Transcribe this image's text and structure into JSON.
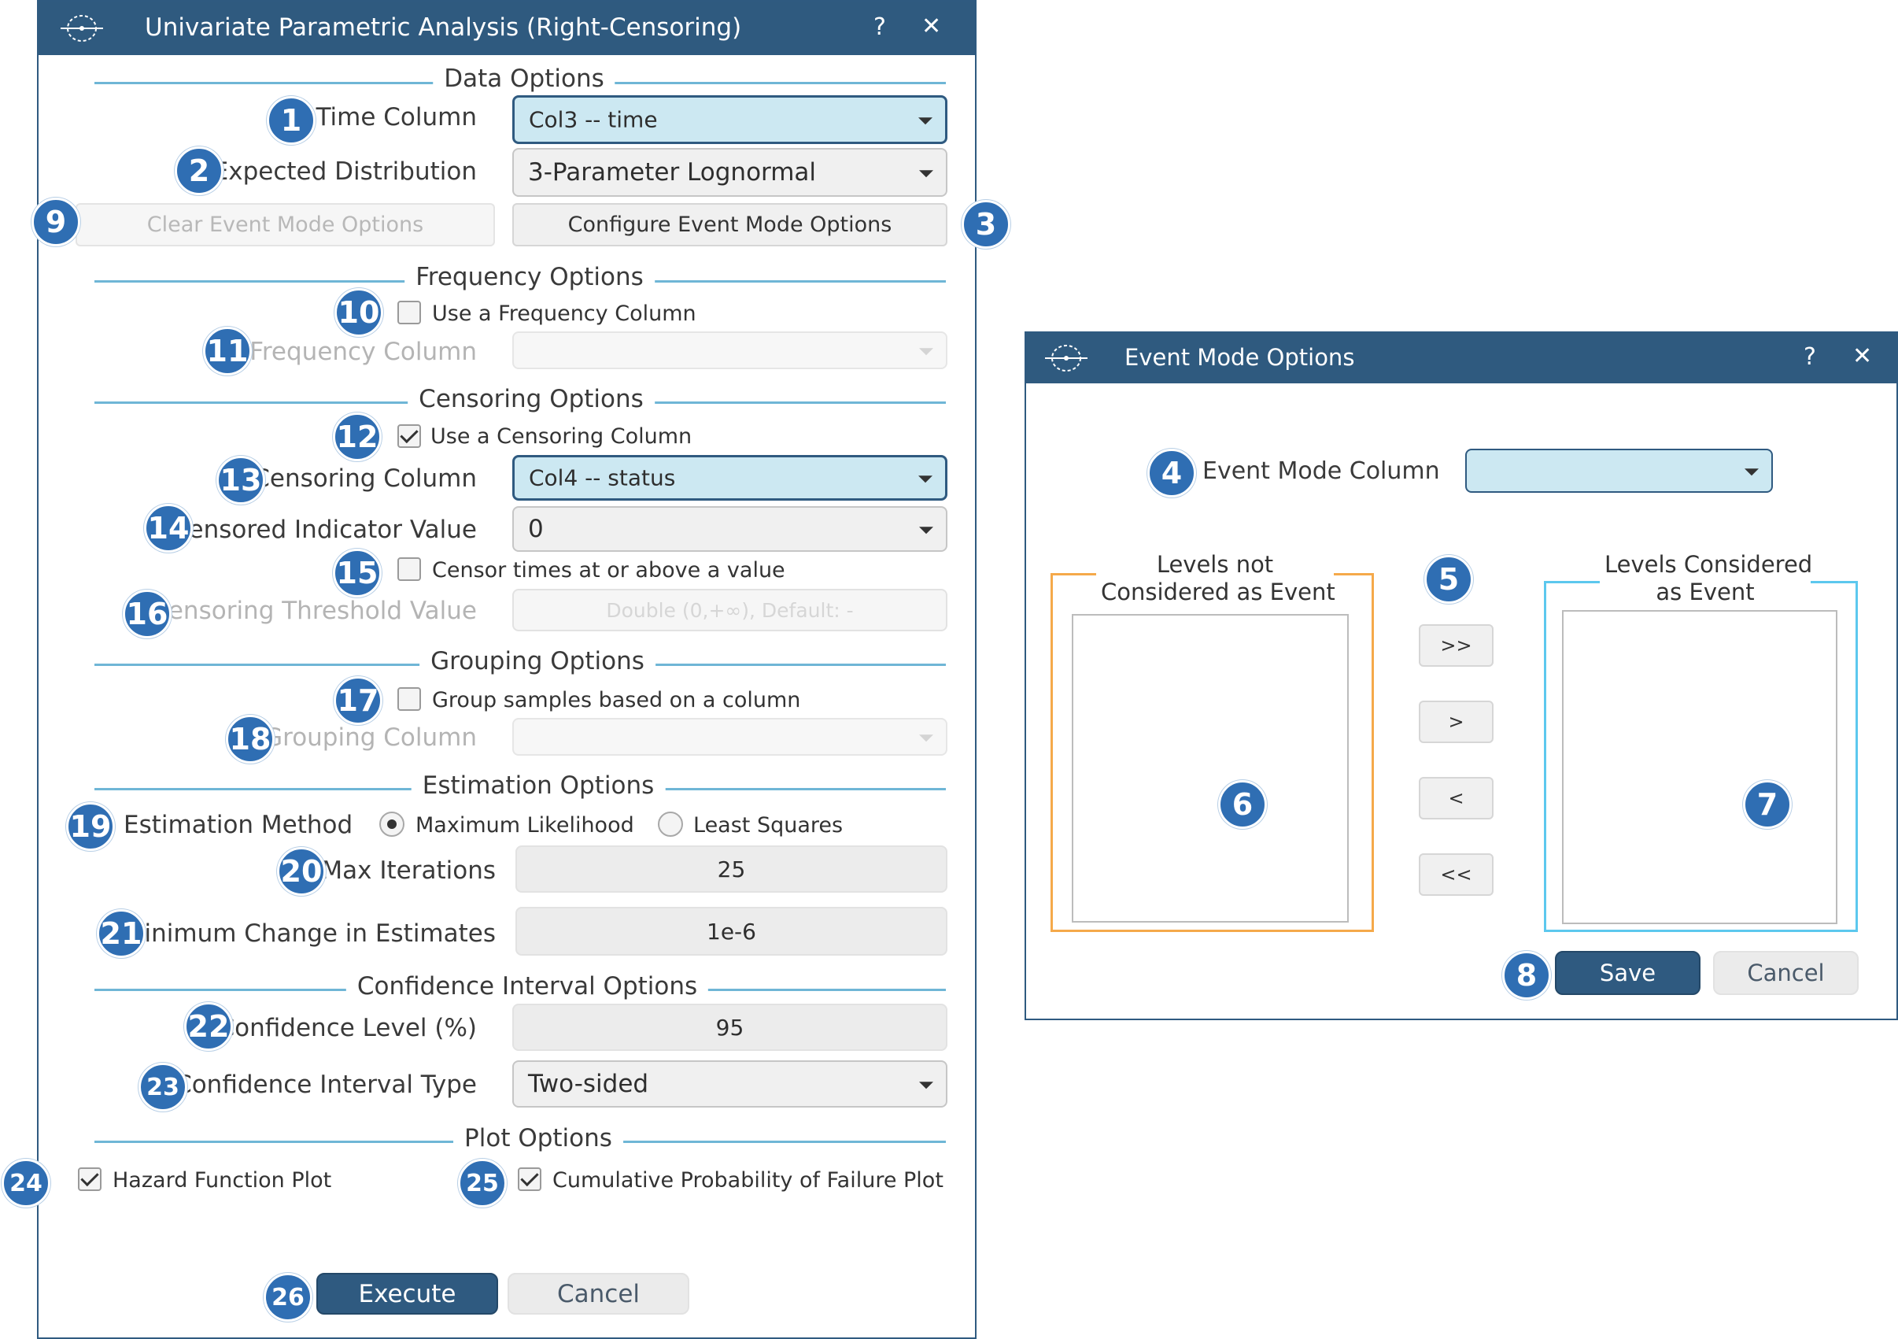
{
  "main_dialog": {
    "title": "Univariate Parametric Analysis (Right-Censoring)",
    "help": "?",
    "close": "✕",
    "sections": {
      "data": "Data Options",
      "frequency": "Frequency Options",
      "censoring": "Censoring Options",
      "grouping": "Grouping Options",
      "estimation": "Estimation Options",
      "confidence": "Confidence Interval Options",
      "plot": "Plot Options"
    },
    "time_column": {
      "label": "Time Column",
      "value": "Col3 -- time"
    },
    "expected_distribution": {
      "label": "Expected Distribution",
      "value": "3-Parameter Lognormal"
    },
    "clear_event_mode": "Clear Event Mode Options",
    "configure_event_mode": "Configure Event Mode Options",
    "use_frequency": {
      "label": "Use a Frequency Column",
      "checked": false
    },
    "frequency_column": {
      "label": "Frequency Column",
      "value": ""
    },
    "use_censoring": {
      "label": "Use a Censoring Column",
      "checked": true
    },
    "censoring_column": {
      "label": "Censoring Column",
      "value": "Col4 -- status"
    },
    "censored_indicator": {
      "label": "Censored Indicator Value",
      "value": "0"
    },
    "censor_times": {
      "label": "Censor times at or above a value",
      "checked": false
    },
    "censoring_threshold": {
      "label": "Censoring Threshold Value",
      "placeholder": "Double (0,+∞), Default: -"
    },
    "group_samples": {
      "label": "Group samples based on a column",
      "checked": false
    },
    "grouping_column": {
      "label": "Grouping Column",
      "value": ""
    },
    "estimation_method": {
      "label": "Estimation Method",
      "options": [
        "Maximum Likelihood",
        "Least Squares"
      ],
      "selected": "Maximum Likelihood"
    },
    "max_iterations": {
      "label": "Max Iterations",
      "value": "25"
    },
    "min_change": {
      "label": "Minimum Change in Estimates",
      "value": "1e-6"
    },
    "confidence_level": {
      "label": "Confidence Level (%)",
      "value": "95"
    },
    "ci_type": {
      "label": "Confidence Interval Type",
      "value": "Two-sided"
    },
    "hazard_plot": {
      "label": "Hazard Function Plot",
      "checked": true
    },
    "cum_prob_plot": {
      "label": "Cumulative Probability of Failure Plot",
      "checked": true
    },
    "execute": "Execute",
    "cancel": "Cancel"
  },
  "event_dialog": {
    "title": "Event Mode Options",
    "help": "?",
    "close": "✕",
    "event_mode_column": {
      "label": "Event Mode Column",
      "value": ""
    },
    "not_considered_title": "Levels not\nConsidered as Event",
    "considered_title": "Levels Considered\nas Event",
    "move_all_right": ">>",
    "move_right": ">",
    "move_left": "<",
    "move_all_left": "<<",
    "save": "Save",
    "cancel": "Cancel"
  },
  "callouts": [
    "1",
    "2",
    "3",
    "4",
    "5",
    "6",
    "7",
    "8",
    "9",
    "10",
    "11",
    "12",
    "13",
    "14",
    "15",
    "16",
    "17",
    "18",
    "19",
    "20",
    "21",
    "22",
    "23",
    "24",
    "25",
    "26"
  ],
  "colors": {
    "titlebar": "#2f5a7f",
    "callout": "#2f6eb3",
    "section_rule": "#6fb6d6",
    "selected_combo": "#cce8f2",
    "not_considered_border": "#f5a94a",
    "considered_border": "#5cc8ee"
  }
}
